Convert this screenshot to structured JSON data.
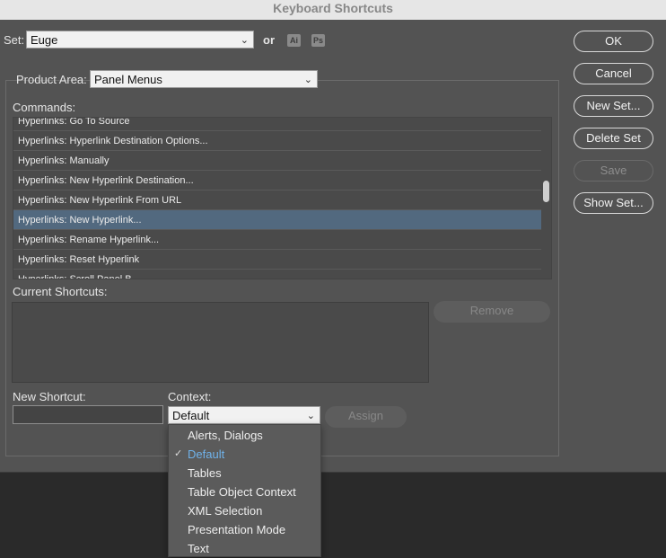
{
  "window": {
    "title": "Keyboard Shortcuts"
  },
  "set": {
    "label": "Set:",
    "value": "Euge",
    "or_label": "or",
    "badges": [
      "Ai",
      "Ps"
    ]
  },
  "buttons": {
    "ok": "OK",
    "cancel": "Cancel",
    "new_set": "New Set...",
    "delete_set": "Delete Set",
    "save": "Save",
    "show_set": "Show Set..."
  },
  "product_area": {
    "label": "Product Area:",
    "value": "Panel Menus"
  },
  "commands": {
    "label": "Commands:",
    "items": [
      {
        "text": "Hyperlinks: Go To Source",
        "selected": false
      },
      {
        "text": "Hyperlinks: Hyperlink Destination Options...",
        "selected": false
      },
      {
        "text": "Hyperlinks: Manually",
        "selected": false
      },
      {
        "text": "Hyperlinks: New Hyperlink Destination...",
        "selected": false
      },
      {
        "text": "Hyperlinks: New Hyperlink From URL",
        "selected": false
      },
      {
        "text": "Hyperlinks: New Hyperlink...",
        "selected": true
      },
      {
        "text": "Hyperlinks: Rename Hyperlink...",
        "selected": false
      },
      {
        "text": "Hyperlinks: Reset Hyperlink",
        "selected": false
      },
      {
        "text": "Hyperlinks: Scroll Panel B...",
        "selected": false
      }
    ]
  },
  "current_shortcuts": {
    "label": "Current Shortcuts:",
    "remove_label": "Remove"
  },
  "new_shortcut": {
    "label": "New Shortcut:",
    "value": ""
  },
  "context": {
    "label": "Context:",
    "value": "Default",
    "assign_label": "Assign",
    "options": [
      {
        "text": "Alerts, Dialogs",
        "checked": false
      },
      {
        "text": "Default",
        "checked": true
      },
      {
        "text": "Tables",
        "checked": false
      },
      {
        "text": "Table Object Context",
        "checked": false
      },
      {
        "text": "XML Selection",
        "checked": false
      },
      {
        "text": "Presentation Mode",
        "checked": false
      },
      {
        "text": "Text",
        "checked": false
      }
    ]
  },
  "colors": {
    "selection": "#52697f",
    "checked_item": "#6fb2ea",
    "dialog_bg": "#535353"
  }
}
